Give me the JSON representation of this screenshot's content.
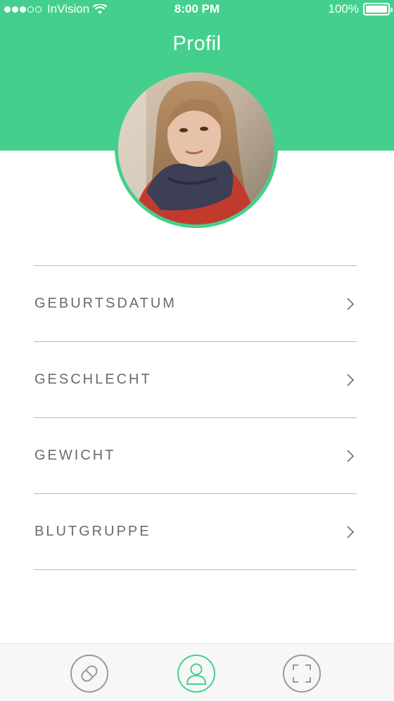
{
  "status_bar": {
    "carrier": "InVision",
    "time": "8:00 PM",
    "battery": "100%"
  },
  "header": {
    "title": "Profil"
  },
  "profile": {
    "photo": "profile-photo"
  },
  "fields": [
    {
      "label": "GEBURTSDATUM"
    },
    {
      "label": "GESCHLECHT"
    },
    {
      "label": "GEWICHT"
    },
    {
      "label": "BLUTGRUPPE"
    }
  ],
  "tabbar": {
    "tabs": [
      {
        "icon": "pill-icon",
        "active": false
      },
      {
        "icon": "person-icon",
        "active": true
      },
      {
        "icon": "scan-icon",
        "active": false
      }
    ]
  },
  "colors": {
    "accent": "#44d08c",
    "text": "#6b6b6b",
    "divider": "#b9b9b9",
    "inactive_icon": "#9a9a9a"
  }
}
